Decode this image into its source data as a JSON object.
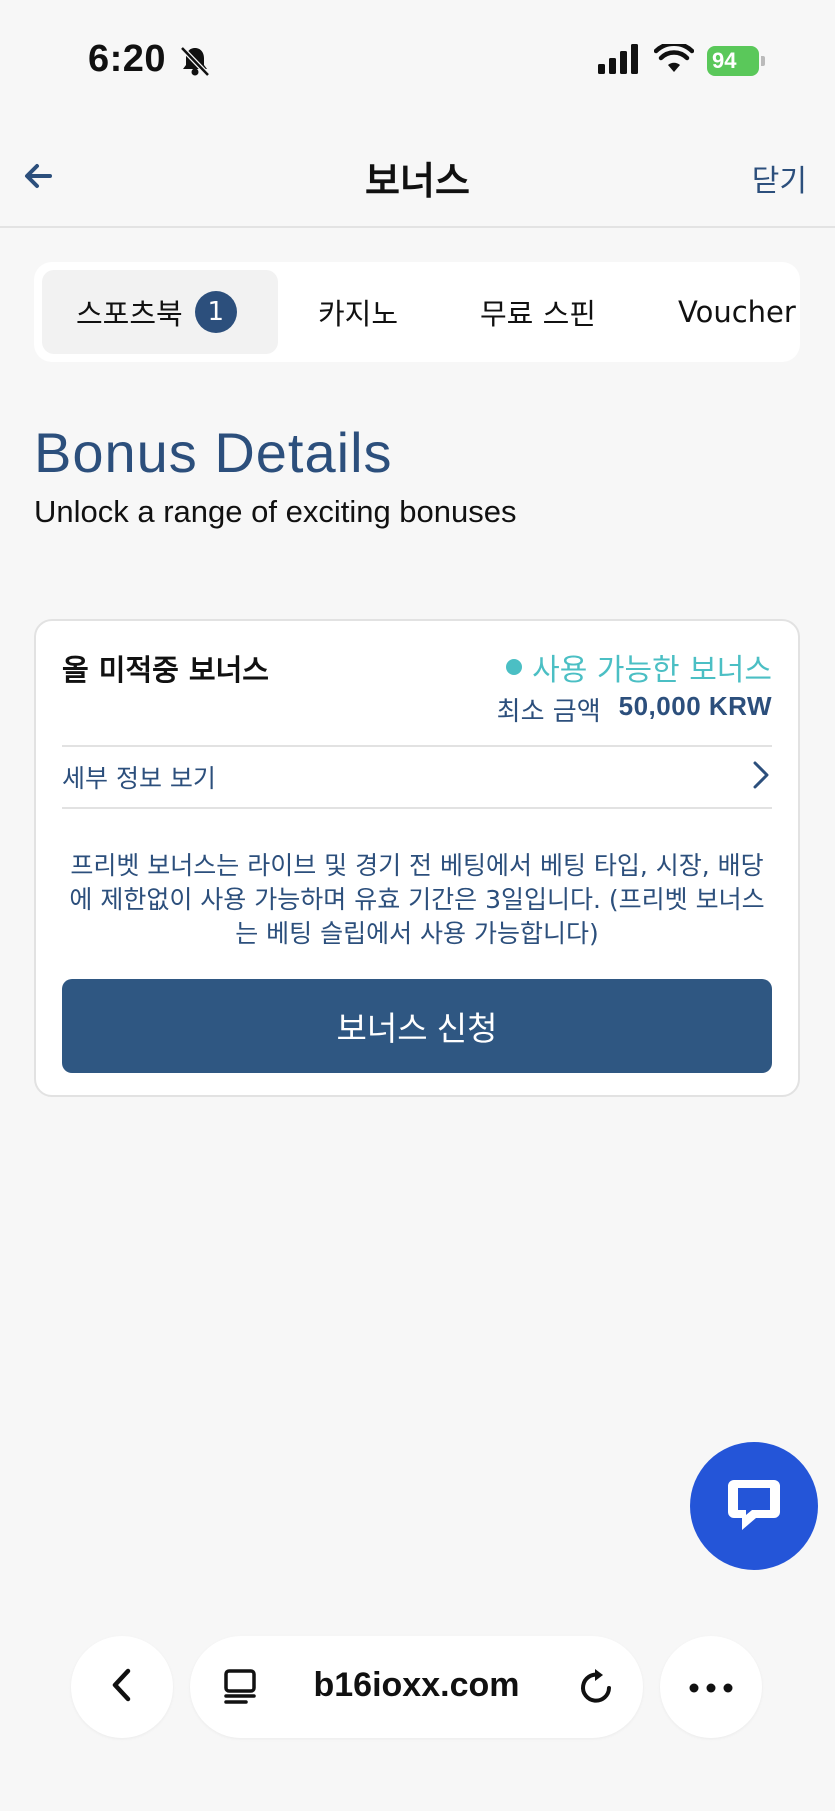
{
  "status_bar": {
    "time": "6:20",
    "battery": "94"
  },
  "header": {
    "title": "보너스",
    "close_label": "닫기"
  },
  "tabs": [
    {
      "label": "스포츠북",
      "badge": "1",
      "active": true
    },
    {
      "label": "카지노"
    },
    {
      "label": "무료 스핀"
    },
    {
      "label": "Voucher"
    }
  ],
  "section": {
    "heading": "Bonus Details",
    "subtitle": "Unlock a range of exciting bonuses"
  },
  "bonus_card": {
    "title": "올 미적중 보너스",
    "status": "사용 가능한 보너스",
    "min_label": "최소 금액",
    "min_value": "50,000 KRW",
    "details_label": "세부 정보 보기",
    "description": "프리벳 보너스는 라이브 및 경기 전 베팅에서 베팅 타입, 시장, 배당에 제한없이 사용 가능하며 유효 기간은 3일입니다. (프리벳 보너스는 베팅 슬립에서 사용 가능합니다)",
    "button_label": "보너스 신청"
  },
  "browser": {
    "url": "b16ioxx.com"
  },
  "colors": {
    "accent": "#2c4f7c",
    "status": "#4bbfc4",
    "chat": "#2455d8"
  }
}
